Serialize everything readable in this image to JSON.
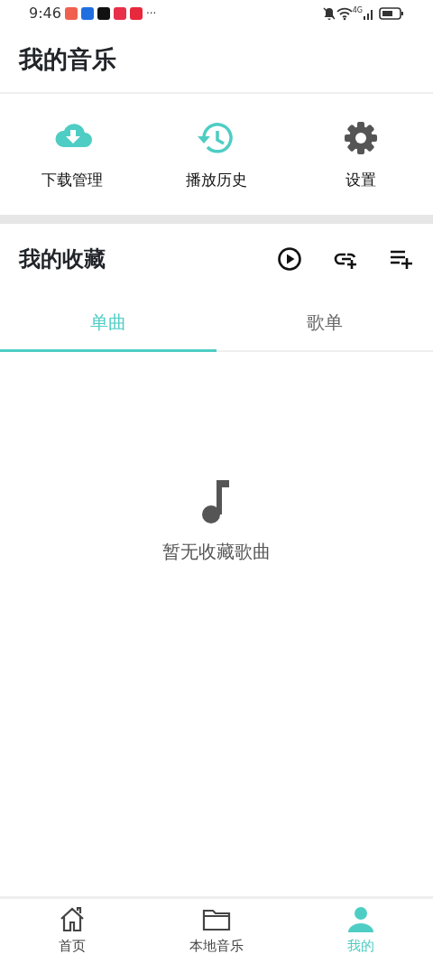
{
  "status_bar": {
    "time": "9:46",
    "app_icons": [
      {
        "color": "#f0604f"
      },
      {
        "color": "#1f6fe0"
      },
      {
        "color": "#111111"
      },
      {
        "color": "#e8304a"
      },
      {
        "color": "#e8283c"
      }
    ],
    "more": "···",
    "network": "4G"
  },
  "header": {
    "title": "我的音乐"
  },
  "quick_actions": [
    {
      "kind": "download",
      "label": "下载管理"
    },
    {
      "kind": "history",
      "label": "播放历史"
    },
    {
      "kind": "settings",
      "label": "设置"
    }
  ],
  "favorites": {
    "title": "我的收藏",
    "actions": [
      {
        "kind": "play"
      },
      {
        "kind": "link-add"
      },
      {
        "kind": "playlist-add"
      }
    ]
  },
  "tabs": [
    {
      "label": "单曲",
      "selected": true
    },
    {
      "label": "歌单",
      "selected": false
    }
  ],
  "empty_state": {
    "message": "暂无收藏歌曲"
  },
  "bottom_nav": [
    {
      "kind": "home",
      "label": "首页",
      "selected": false
    },
    {
      "kind": "folder",
      "label": "本地音乐",
      "selected": false
    },
    {
      "kind": "person",
      "label": "我的",
      "selected": true
    }
  ]
}
